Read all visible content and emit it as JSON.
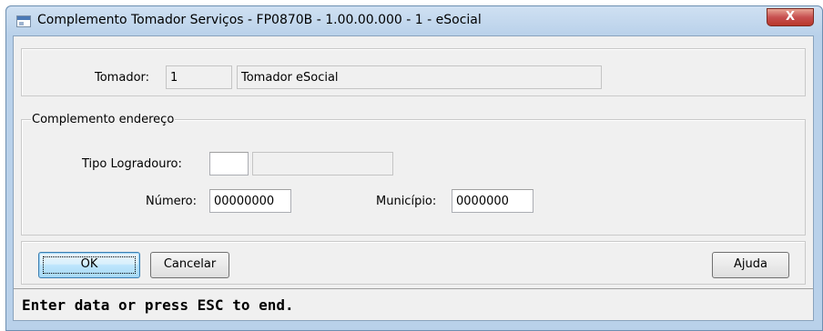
{
  "window": {
    "title": "Complemento Tomador Serviços - FP0870B - 1.00.00.000 - 1 - eSocial",
    "close_glyph": "X"
  },
  "tomador": {
    "label": "Tomador:",
    "code": "1",
    "name": "Tomador eSocial"
  },
  "complemento": {
    "legend": "Complemento endereço",
    "tipo_logradouro_label": "Tipo Logradouro:",
    "tipo_logradouro_code": "",
    "tipo_logradouro_desc": "",
    "numero_label": "Número:",
    "numero_value": "00000000",
    "municipio_label": "Município:",
    "municipio_value": "0000000"
  },
  "buttons": {
    "ok": "OK",
    "cancel": "Cancelar",
    "help": "Ajuda"
  },
  "status": {
    "text": "Enter data or press ESC to end."
  }
}
